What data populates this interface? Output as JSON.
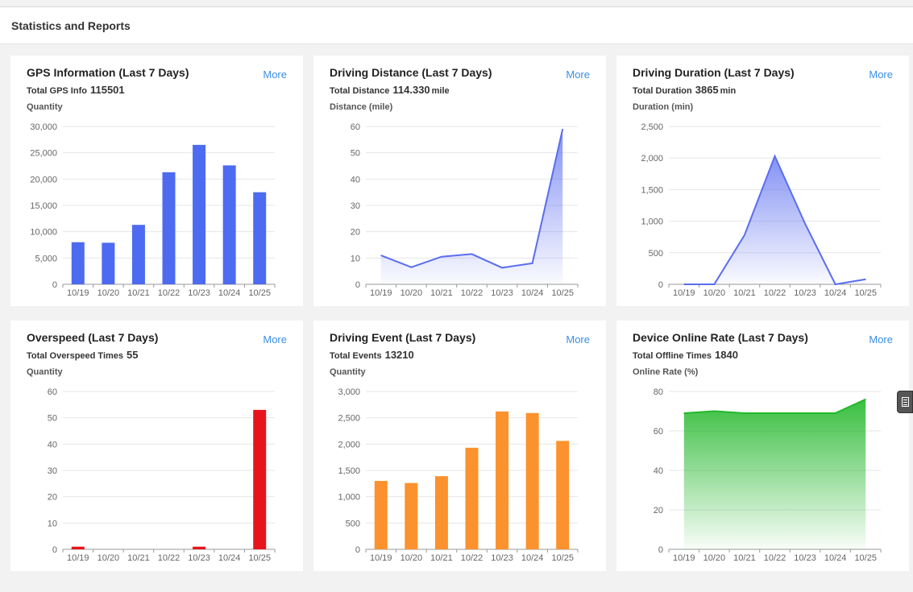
{
  "page": {
    "title": "Statistics and Reports"
  },
  "cards": [
    {
      "title": "GPS Information (Last 7 Days)",
      "more": "More",
      "total_label": "Total GPS Info",
      "total_value": "115501",
      "total_unit": "",
      "ylabel": "Quantity"
    },
    {
      "title": "Driving Distance (Last 7 Days)",
      "more": "More",
      "total_label": "Total Distance",
      "total_value": "114.330",
      "total_unit": "mile",
      "ylabel": "Distance (mile)"
    },
    {
      "title": "Driving Duration (Last 7 Days)",
      "more": "More",
      "total_label": "Total Duration",
      "total_value": "3865",
      "total_unit": "min",
      "ylabel": "Duration (min)"
    },
    {
      "title": "Overspeed (Last 7 Days)",
      "more": "More",
      "total_label": "Total Overspeed Times",
      "total_value": "55",
      "total_unit": "",
      "ylabel": "Quantity"
    },
    {
      "title": "Driving Event (Last 7 Days)",
      "more": "More",
      "total_label": "Total Events",
      "total_value": "13210",
      "total_unit": "",
      "ylabel": "Quantity"
    },
    {
      "title": "Device Online Rate (Last 7 Days)",
      "more": "More",
      "total_label": "Total Offline Times",
      "total_value": "1840",
      "total_unit": "",
      "ylabel": "Online Rate (%)"
    }
  ],
  "chart_data": [
    {
      "type": "bar",
      "categories": [
        "10/19",
        "10/20",
        "10/21",
        "10/22",
        "10/23",
        "10/24",
        "10/25"
      ],
      "values": [
        8000,
        7900,
        11300,
        21300,
        26500,
        22600,
        17500
      ],
      "ylim": [
        0,
        30000
      ],
      "yticks": [
        "0",
        "5,000",
        "10,000",
        "15,000",
        "20,000",
        "25,000",
        "30,000"
      ],
      "color": "#4d6bf0"
    },
    {
      "type": "area",
      "categories": [
        "10/19",
        "10/20",
        "10/21",
        "10/22",
        "10/23",
        "10/24",
        "10/25"
      ],
      "values": [
        11,
        6.5,
        10.5,
        11.5,
        6.3,
        8,
        59
      ],
      "ylim": [
        0,
        60
      ],
      "yticks": [
        "0",
        "10",
        "20",
        "30",
        "40",
        "50",
        "60"
      ],
      "color": "#5a6df0"
    },
    {
      "type": "area",
      "categories": [
        "10/19",
        "10/20",
        "10/21",
        "10/22",
        "10/23",
        "10/24",
        "10/25"
      ],
      "values": [
        0,
        0,
        780,
        2030,
        960,
        0,
        80
      ],
      "ylim": [
        0,
        2500
      ],
      "yticks": [
        "0",
        "500",
        "1,000",
        "1,500",
        "2,000",
        "2,500"
      ],
      "color": "#5a6df0"
    },
    {
      "type": "bar",
      "categories": [
        "10/19",
        "10/20",
        "10/21",
        "10/22",
        "10/23",
        "10/24",
        "10/25"
      ],
      "values": [
        1,
        0,
        0,
        0,
        1,
        0,
        53
      ],
      "ylim": [
        0,
        60
      ],
      "yticks": [
        "0",
        "10",
        "20",
        "30",
        "40",
        "50",
        "60"
      ],
      "color": "#e8141c"
    },
    {
      "type": "bar",
      "categories": [
        "10/19",
        "10/20",
        "10/21",
        "10/22",
        "10/23",
        "10/24",
        "10/25"
      ],
      "values": [
        1300,
        1260,
        1390,
        1930,
        2620,
        2590,
        2060
      ],
      "ylim": [
        0,
        3000
      ],
      "yticks": [
        "0",
        "500",
        "1,000",
        "1,500",
        "2,000",
        "2,500",
        "3,000"
      ],
      "color": "#fb922d"
    },
    {
      "type": "area",
      "categories": [
        "10/19",
        "10/20",
        "10/21",
        "10/22",
        "10/23",
        "10/24",
        "10/25"
      ],
      "values": [
        69,
        70,
        69,
        69,
        69,
        69,
        76
      ],
      "ylim": [
        0,
        80
      ],
      "yticks": [
        "0",
        "20",
        "40",
        "60",
        "80"
      ],
      "color": "#22b82a"
    }
  ]
}
